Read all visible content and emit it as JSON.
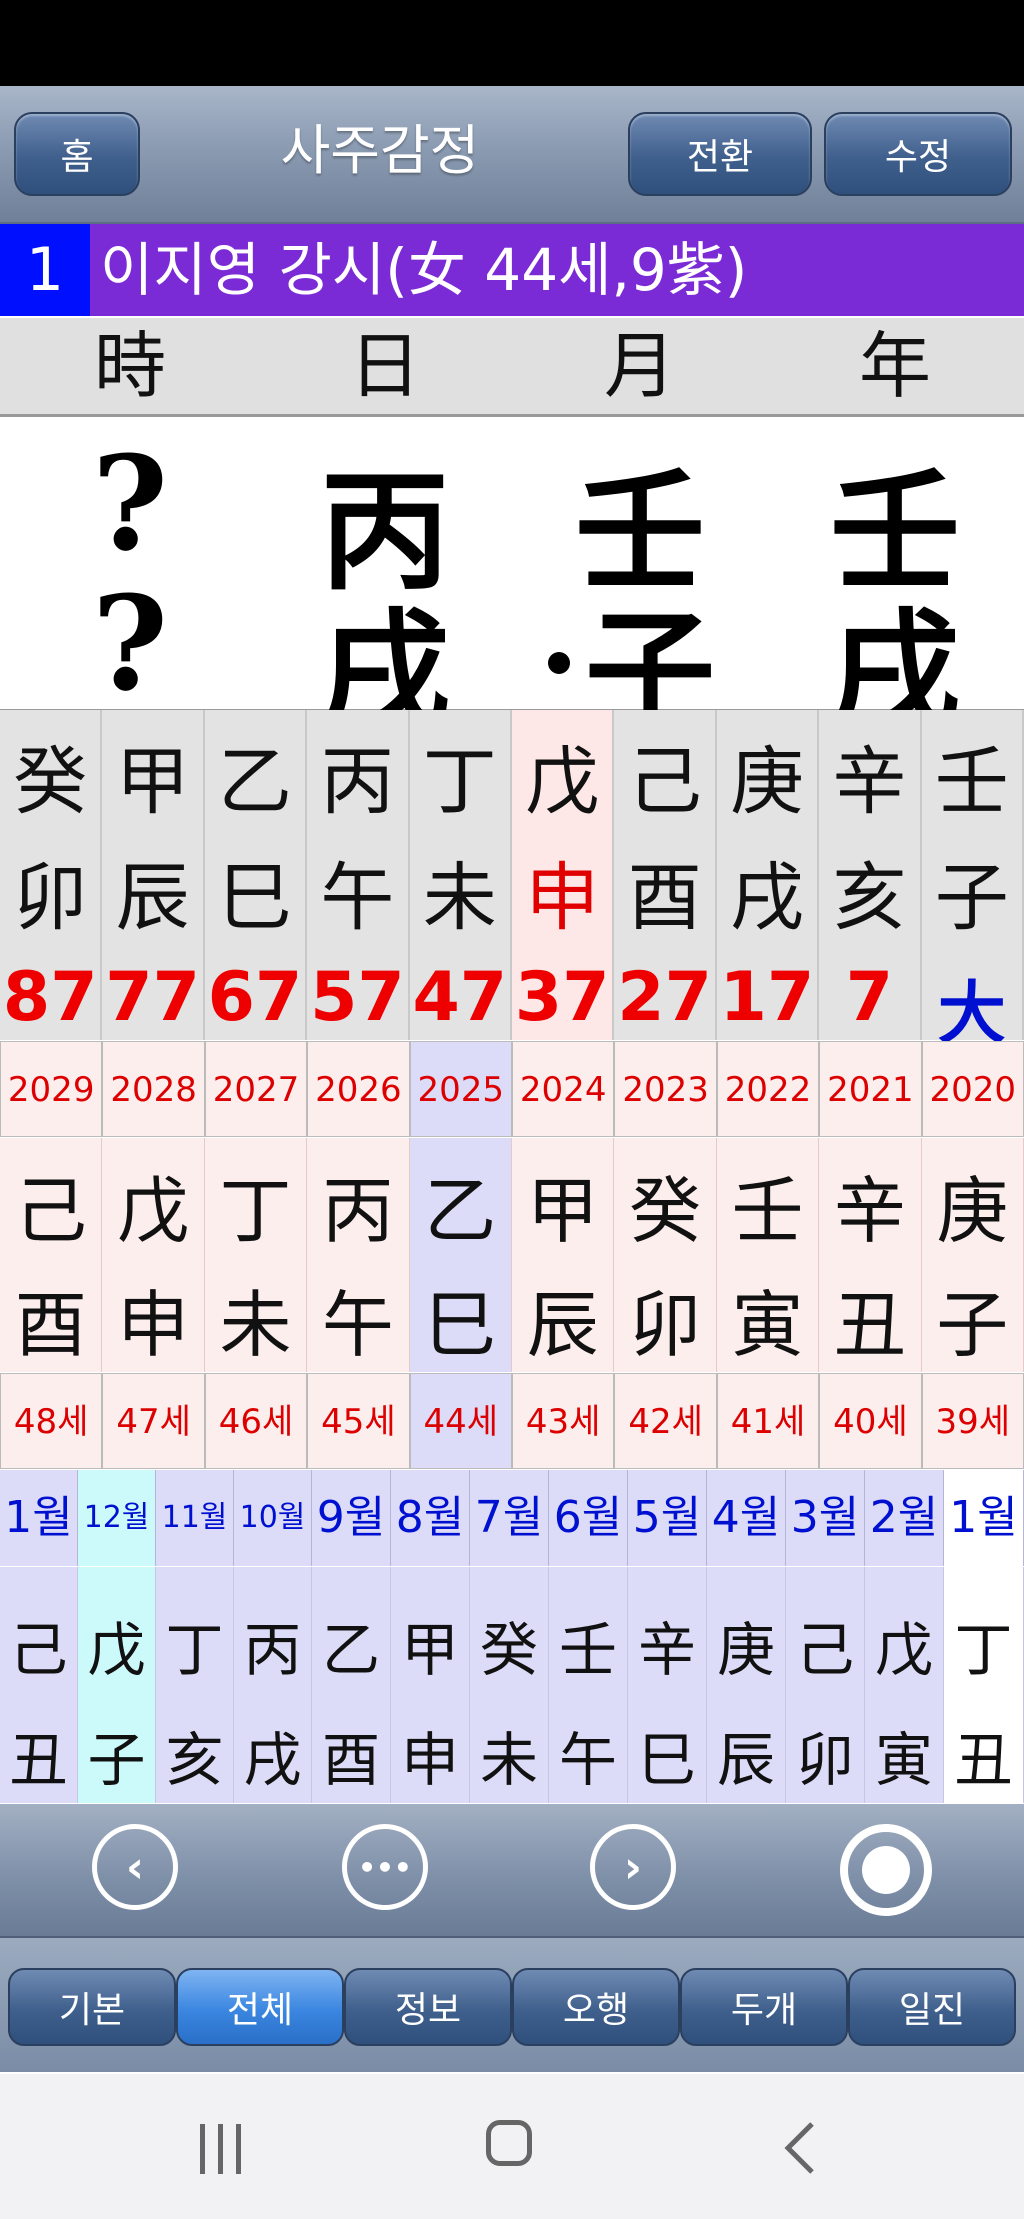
{
  "header": {
    "home": "홈",
    "title": "사주감정",
    "switch": "전환",
    "edit": "수정"
  },
  "person": {
    "num": "1",
    "name": "이지영 강시(女 44세,9紫)"
  },
  "pillar_labels": [
    "時",
    "日",
    "月",
    "年"
  ],
  "pillars": {
    "hour": {
      "stem": "?",
      "branch": "?"
    },
    "day": {
      "stem": "丙",
      "branch": "戌"
    },
    "month": {
      "stem": "壬",
      "branch": "子"
    },
    "year": {
      "stem": "壬",
      "branch": "戌"
    }
  },
  "daeun": [
    {
      "stem": "癸",
      "branch": "卯",
      "age": "87"
    },
    {
      "stem": "甲",
      "branch": "辰",
      "age": "77"
    },
    {
      "stem": "乙",
      "branch": "巳",
      "age": "67"
    },
    {
      "stem": "丙",
      "branch": "午",
      "age": "57"
    },
    {
      "stem": "丁",
      "branch": "未",
      "age": "47"
    },
    {
      "stem": "戊",
      "branch": "申",
      "age": "37"
    },
    {
      "stem": "己",
      "branch": "酉",
      "age": "27"
    },
    {
      "stem": "庚",
      "branch": "戌",
      "age": "17"
    },
    {
      "stem": "辛",
      "branch": "亥",
      "age": "7"
    },
    {
      "stem": "壬",
      "branch": "子",
      "age": "大"
    }
  ],
  "years": [
    {
      "year": "2029",
      "stem": "己",
      "branch": "酉",
      "age": "48세"
    },
    {
      "year": "2028",
      "stem": "戊",
      "branch": "申",
      "age": "47세"
    },
    {
      "year": "2027",
      "stem": "丁",
      "branch": "未",
      "age": "46세"
    },
    {
      "year": "2026",
      "stem": "丙",
      "branch": "午",
      "age": "45세"
    },
    {
      "year": "2025",
      "stem": "乙",
      "branch": "巳",
      "age": "44세"
    },
    {
      "year": "2024",
      "stem": "甲",
      "branch": "辰",
      "age": "43세"
    },
    {
      "year": "2023",
      "stem": "癸",
      "branch": "卯",
      "age": "42세"
    },
    {
      "year": "2022",
      "stem": "壬",
      "branch": "寅",
      "age": "41세"
    },
    {
      "year": "2021",
      "stem": "辛",
      "branch": "丑",
      "age": "40세"
    },
    {
      "year": "2020",
      "stem": "庚",
      "branch": "子",
      "age": "39세"
    }
  ],
  "months": [
    {
      "label": "1월",
      "stem": "己",
      "branch": "丑"
    },
    {
      "label": "12월",
      "stem": "戊",
      "branch": "子"
    },
    {
      "label": "11월",
      "stem": "丁",
      "branch": "亥"
    },
    {
      "label": "10월",
      "stem": "丙",
      "branch": "戌"
    },
    {
      "label": "9월",
      "stem": "乙",
      "branch": "酉"
    },
    {
      "label": "8월",
      "stem": "甲",
      "branch": "申"
    },
    {
      "label": "7월",
      "stem": "癸",
      "branch": "未"
    },
    {
      "label": "6월",
      "stem": "壬",
      "branch": "午"
    },
    {
      "label": "5월",
      "stem": "辛",
      "branch": "巳"
    },
    {
      "label": "4월",
      "stem": "庚",
      "branch": "辰"
    },
    {
      "label": "3월",
      "stem": "己",
      "branch": "卯"
    },
    {
      "label": "2월",
      "stem": "戊",
      "branch": "寅"
    },
    {
      "label": "1월",
      "stem": "丁",
      "branch": "丑"
    }
  ],
  "nav": {
    "prev": "‹",
    "more": "•••",
    "next": "›"
  },
  "tabs": [
    "기본",
    "전체",
    "정보",
    "오행",
    "두개",
    "일진"
  ],
  "colors": {
    "accent_red": "#e00000",
    "accent_blue": "#0010d0",
    "purple": "#7b2bd6",
    "blue": "#0010ff"
  }
}
